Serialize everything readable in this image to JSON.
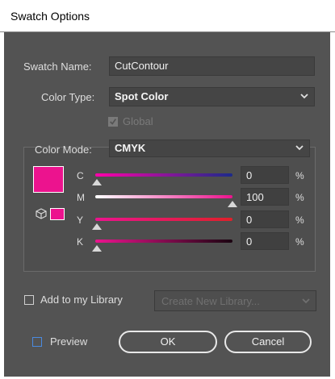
{
  "window": {
    "title": "Swatch Options"
  },
  "form": {
    "swatch_name_label": "Swatch Name:",
    "swatch_name_value": "CutContour",
    "color_type_label": "Color Type:",
    "color_type_value": "Spot Color",
    "global_label": "Global",
    "global_checked": true,
    "color_mode_label": "Color Mode:",
    "color_mode_value": "CMYK"
  },
  "channels": [
    {
      "label": "C",
      "value": "0",
      "unit": "%",
      "level": 0
    },
    {
      "label": "M",
      "value": "100",
      "unit": "%",
      "level": 100
    },
    {
      "label": "Y",
      "value": "0",
      "unit": "%",
      "level": 0
    },
    {
      "label": "K",
      "value": "0",
      "unit": "%",
      "level": 0
    }
  ],
  "library": {
    "add_label": "Add to my Library",
    "create_placeholder": "Create New Library..."
  },
  "footer": {
    "preview_label": "Preview",
    "ok_label": "OK",
    "cancel_label": "Cancel"
  },
  "colors": {
    "swatch": "#ec138e",
    "panel": "#535353",
    "field": "#454545"
  },
  "icons": [
    "chevron-down-icon",
    "checkmark-icon",
    "cube-icon",
    "slider-thumb-icon"
  ]
}
